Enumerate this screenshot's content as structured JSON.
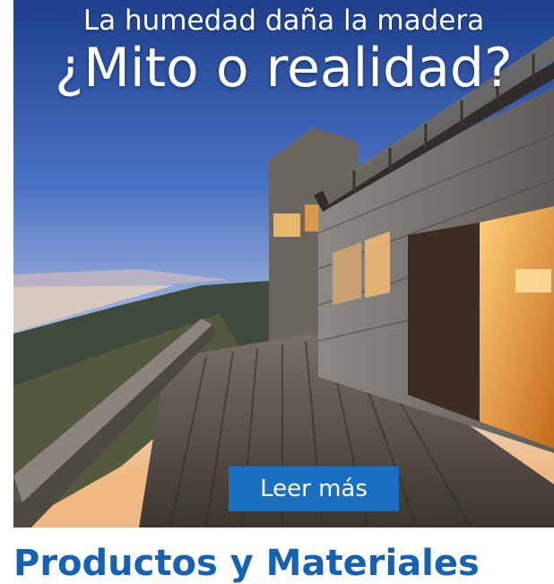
{
  "banner": {
    "headline_top": "La humedad daña la madera",
    "headline_main": "¿Mito o realidad?",
    "cta_label": "Leer más",
    "cta_color": "#1a6fc0"
  },
  "section": {
    "heading": "Productos y Materiales",
    "heading_color": "#1561b4"
  }
}
